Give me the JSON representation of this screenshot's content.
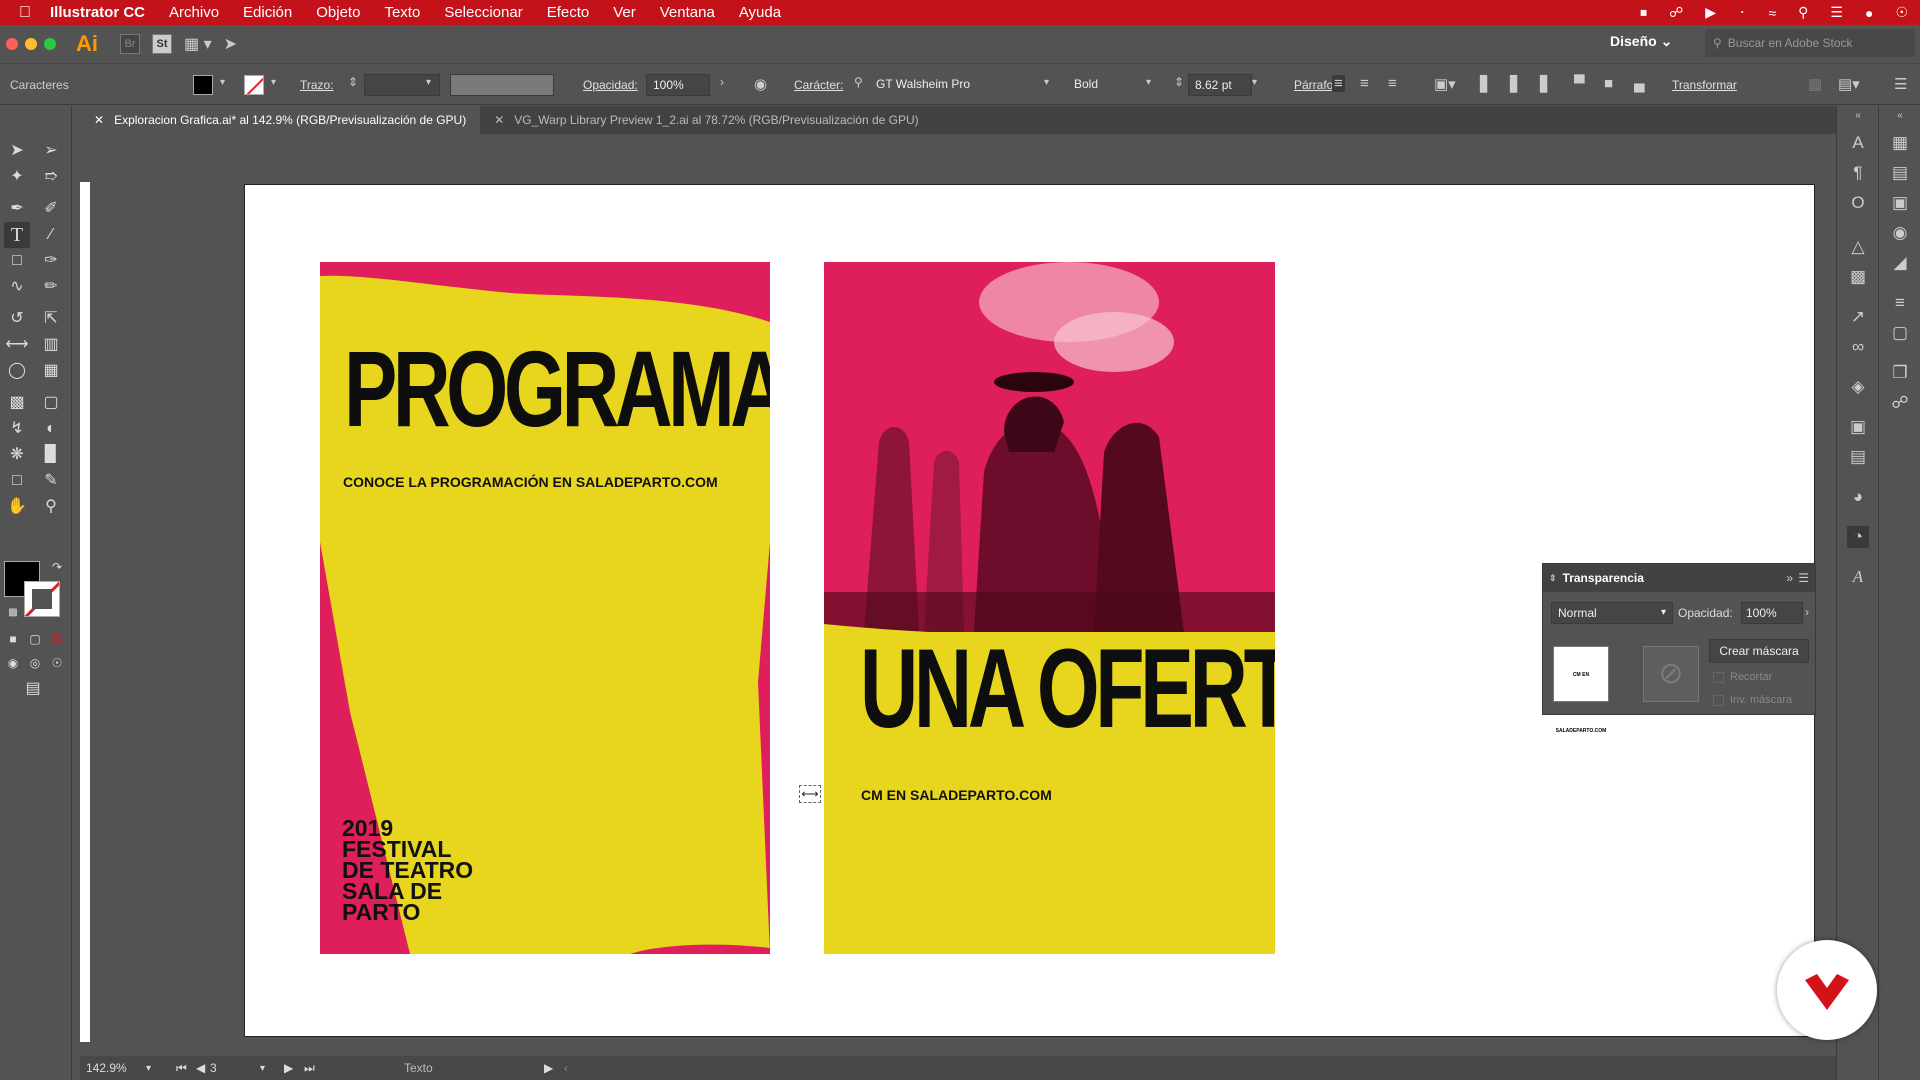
{
  "menubar": {
    "app_name": "Illustrator CC",
    "items": [
      "Archivo",
      "Edición",
      "Objeto",
      "Texto",
      "Seleccionar",
      "Efecto",
      "Ver",
      "Ventana",
      "Ayuda"
    ]
  },
  "appbar": {
    "logo": "Ai",
    "bridge": "Br",
    "stock": "St",
    "workspace": "Diseño",
    "search_placeholder": "Buscar en Adobe Stock"
  },
  "controlbar": {
    "panel_label": "Caracteres",
    "stroke_label": "Trazo:",
    "opacity_label": "Opacidad:",
    "opacity_value": "100%",
    "character_label": "Carácter:",
    "font_family": "GT Walsheim Pro",
    "font_style": "Bold",
    "font_size": "8.62 pt",
    "paragraph_label": "Párrafo:",
    "transform_label": "Transformar"
  },
  "tabs": [
    {
      "label": "Exploracion Grafica.ai* al 142.9% (RGB/Previsualización de GPU)",
      "active": true
    },
    {
      "label": "VG_Warp Library Preview 1_2.ai al 78.72% (RGB/Previsualización de GPU)",
      "active": false
    }
  ],
  "poster1": {
    "headline": "PROGRAMA",
    "subline_prefix": "CONOCE LA PROGRAMACIÓN EN ",
    "subline_site": "SALADEPARTO.COM",
    "festival_lines": [
      "2019",
      "FESTIVAL",
      "DE TEATRO",
      "SALA DE",
      "PARTO"
    ]
  },
  "poster2": {
    "headline": "UNA OFERTA",
    "subline_prefix": "CM EN ",
    "subline_site": "SALADEPARTO.COM"
  },
  "transparency": {
    "title": "Transparencia",
    "blend_mode": "Normal",
    "opacity_label": "Opacidad:",
    "opacity_value": "100%",
    "thumb_text": "CM EN SALADEPARTO.COM",
    "make_mask": "Crear máscara",
    "clip": "Recortar",
    "invert": "Inv. máscara"
  },
  "statusbar": {
    "zoom": "142.9%",
    "artboard": "3",
    "tool": "Texto"
  },
  "colors": {
    "menubar": "#c4121a",
    "poster_yellow": "#e7d51e",
    "poster_pink": "#de1f5b",
    "ui_gray": "#535353"
  }
}
